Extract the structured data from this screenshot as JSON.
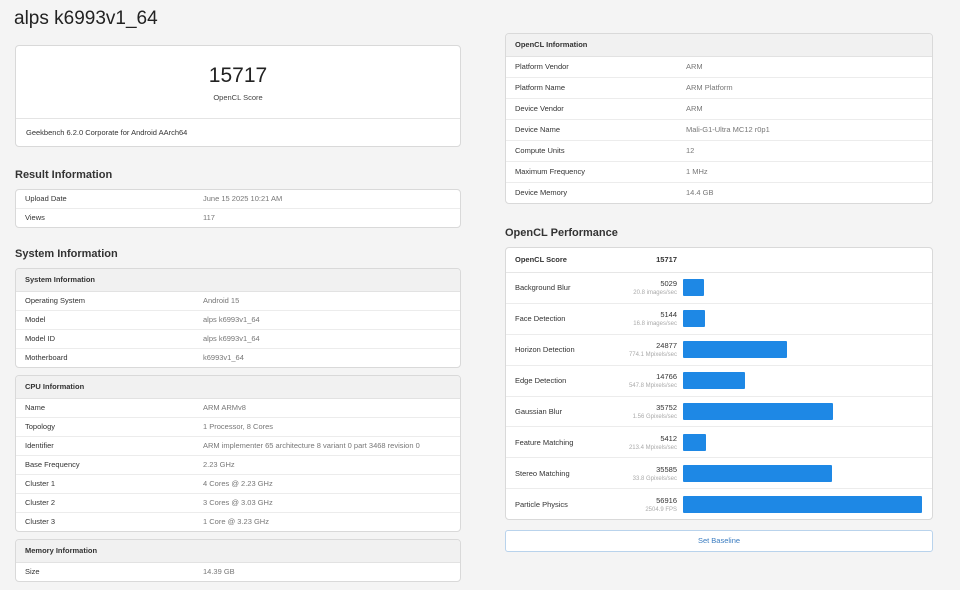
{
  "title": "alps k6993v1_64",
  "score_card": {
    "score": "15717",
    "score_label": "OpenCL Score",
    "version": "Geekbench 6.2.0 Corporate for Android AArch64"
  },
  "result_info": {
    "heading": "Result Information",
    "rows": [
      {
        "k": "Upload Date",
        "v": "June 15 2025 10:21 AM"
      },
      {
        "k": "Views",
        "v": "117"
      }
    ]
  },
  "system_info": {
    "heading": "System Information",
    "system": {
      "header": "System Information",
      "rows": [
        {
          "k": "Operating System",
          "v": "Android 15"
        },
        {
          "k": "Model",
          "v": "alps k6993v1_64"
        },
        {
          "k": "Model ID",
          "v": "alps k6993v1_64"
        },
        {
          "k": "Motherboard",
          "v": "k6993v1_64"
        }
      ]
    },
    "cpu": {
      "header": "CPU Information",
      "rows": [
        {
          "k": "Name",
          "v": "ARM ARMv8"
        },
        {
          "k": "Topology",
          "v": "1 Processor, 8 Cores"
        },
        {
          "k": "Identifier",
          "v": "ARM implementer 65 architecture 8 variant 0 part 3468 revision 0"
        },
        {
          "k": "Base Frequency",
          "v": "2.23 GHz"
        },
        {
          "k": "Cluster 1",
          "v": "4 Cores @ 2.23 GHz"
        },
        {
          "k": "Cluster 2",
          "v": "3 Cores @ 3.03 GHz"
        },
        {
          "k": "Cluster 3",
          "v": "1 Core @ 3.23 GHz"
        }
      ]
    },
    "memory": {
      "header": "Memory Information",
      "rows": [
        {
          "k": "Size",
          "v": "14.39 GB"
        }
      ]
    }
  },
  "opencl_info": {
    "header": "OpenCL Information",
    "rows": [
      {
        "k": "Platform Vendor",
        "v": "ARM"
      },
      {
        "k": "Platform Name",
        "v": "ARM Platform"
      },
      {
        "k": "Device Vendor",
        "v": "ARM"
      },
      {
        "k": "Device Name",
        "v": "Mali-G1-Ultra MC12 r0p1"
      },
      {
        "k": "Compute Units",
        "v": "12"
      },
      {
        "k": "Maximum Frequency",
        "v": "1 MHz"
      },
      {
        "k": "Device Memory",
        "v": "14.4 GB"
      }
    ]
  },
  "opencl_perf": {
    "heading": "OpenCL Performance",
    "score_label": "OpenCL Score",
    "score": "15717",
    "bar_color": "#1e88e5",
    "max_score": 56916,
    "tests": [
      {
        "name": "Background Blur",
        "score": "5029",
        "rate": "20.8 images/sec",
        "value": 5029
      },
      {
        "name": "Face Detection",
        "score": "5144",
        "rate": "16.8 images/sec",
        "value": 5144
      },
      {
        "name": "Horizon Detection",
        "score": "24877",
        "rate": "774.1 Mpixels/sec",
        "value": 24877
      },
      {
        "name": "Edge Detection",
        "score": "14766",
        "rate": "547.8 Mpixels/sec",
        "value": 14766
      },
      {
        "name": "Gaussian Blur",
        "score": "35752",
        "rate": "1.56 Gpixels/sec",
        "value": 35752
      },
      {
        "name": "Feature Matching",
        "score": "5412",
        "rate": "213.4 Mpixels/sec",
        "value": 5412
      },
      {
        "name": "Stereo Matching",
        "score": "35585",
        "rate": "33.8 Gpixels/sec",
        "value": 35585
      },
      {
        "name": "Particle Physics",
        "score": "56916",
        "rate": "2504.9 FPS",
        "value": 56916
      }
    ],
    "baseline_label": "Set Baseline"
  }
}
